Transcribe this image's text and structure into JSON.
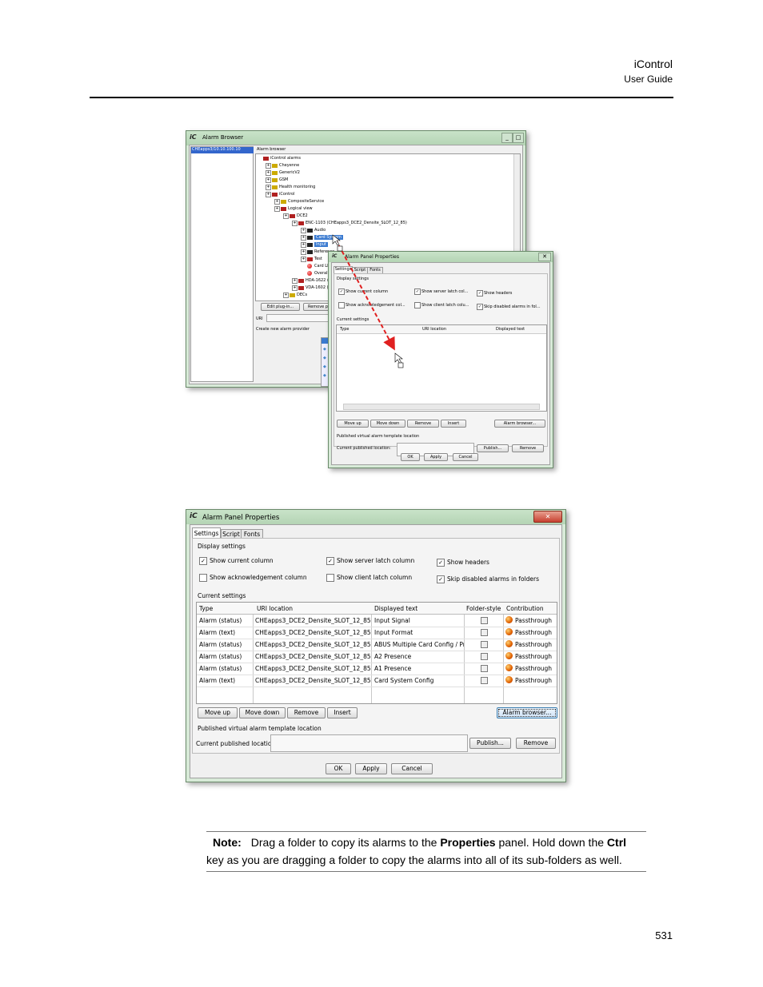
{
  "header": {
    "product": "iControl",
    "doc_type": "User Guide"
  },
  "page_number": "531",
  "figure1": {
    "alarm_browser": {
      "title": "Alarm Browser",
      "server": "CHEapps3/10.10.100.10",
      "panel_label": "Alarm browser",
      "tree": [
        "iControl alarms",
        "Cheyenne",
        "GenericV2",
        "GSM",
        "Health monitoring",
        "iControl",
        "CompositeService",
        "Logical view",
        "DCE2",
        "ENC-1103 (CHEapps3_DCE2_Densite_SLOT_12_85)",
        "Audio",
        "Card System",
        "Input",
        "Reference",
        "Test",
        "Card LED",
        "Overall",
        "HDA-1622 (CH",
        "VDA-1602 (CH",
        "DECs"
      ],
      "buttons": {
        "edit": "Edit plug-in...",
        "remove": "Remove p"
      },
      "uri_label": "URI",
      "create_label": "Create new alarm provider"
    },
    "small_props": {
      "title": "Alarm Panel Properties",
      "tabs": [
        "Settings",
        "Script",
        "Fonts"
      ],
      "display_settings": "Display settings",
      "checks": {
        "current": "Show current column",
        "server": "Show server latch col...",
        "headers": "Show headers",
        "ack": "Show acknowledgement col...",
        "client": "Show client latch colu...",
        "skip": "Skip disabled alarms in fol..."
      },
      "current_settings": "Current settings",
      "columns": [
        "Type",
        "URI location",
        "Displayed text"
      ],
      "buttons": {
        "up": "Move up",
        "down": "Move down",
        "remove": "Remove",
        "insert": "Insert",
        "browser": "Alarm browser..."
      },
      "published_label": "Published virtual alarm template location",
      "current_published": "Current published location:",
      "publish": "Publish...",
      "remove2": "Remove",
      "ok": "OK",
      "apply": "Apply",
      "cancel": "Cancel"
    }
  },
  "figure2": {
    "title": "Alarm Panel Properties",
    "tabs": [
      "Settings",
      "Script",
      "Fonts"
    ],
    "display_settings": "Display settings",
    "checks": {
      "current": "Show current column",
      "server": "Show server latch column",
      "headers": "Show headers",
      "ack": "Show acknowledgement column",
      "client": "Show client latch column",
      "skip": "Skip disabled alarms in folders"
    },
    "current_settings": "Current settings",
    "columns": [
      "Type",
      "URI location",
      "Displayed text",
      "Folder-style",
      "Contribution"
    ],
    "rows": [
      {
        "type": "Alarm (status)",
        "uri": "CHEapps3_DCE2_Densite_SLOT_12_85...",
        "text": "Input Signal",
        "contribution": "Passthrough"
      },
      {
        "type": "Alarm (text)",
        "uri": "CHEapps3_DCE2_Densite_SLOT_12_85...",
        "text": "Input Format",
        "contribution": "Passthrough"
      },
      {
        "type": "Alarm (status)",
        "uri": "CHEapps3_DCE2_Densite_SLOT_12_85...",
        "text": "ABUS Multiple Card Config / Pr...",
        "contribution": "Passthrough"
      },
      {
        "type": "Alarm (status)",
        "uri": "CHEapps3_DCE2_Densite_SLOT_12_85...",
        "text": "A2 Presence",
        "contribution": "Passthrough"
      },
      {
        "type": "Alarm (status)",
        "uri": "CHEapps3_DCE2_Densite_SLOT_12_85...",
        "text": "A1 Presence",
        "contribution": "Passthrough"
      },
      {
        "type": "Alarm (text)",
        "uri": "CHEapps3_DCE2_Densite_SLOT_12_85...",
        "text": "Card System Config",
        "contribution": "Passthrough"
      }
    ],
    "buttons": {
      "up": "Move up",
      "down": "Move down",
      "remove": "Remove",
      "insert": "Insert",
      "browser": "Alarm browser..."
    },
    "published_label": "Published virtual alarm template location",
    "current_published": "Current published location:",
    "publish": "Publish...",
    "remove2": "Remove",
    "ok": "OK",
    "apply": "Apply",
    "cancel": "Cancel"
  },
  "note": {
    "label": "Note:",
    "t1": "Drag a folder to copy its alarms to the ",
    "b1": "Properties",
    "t2": " panel. Hold down the ",
    "b2": "Ctrl",
    "t3": " key as you are dragging a folder to copy the alarms into all of its sub-folders as well."
  }
}
